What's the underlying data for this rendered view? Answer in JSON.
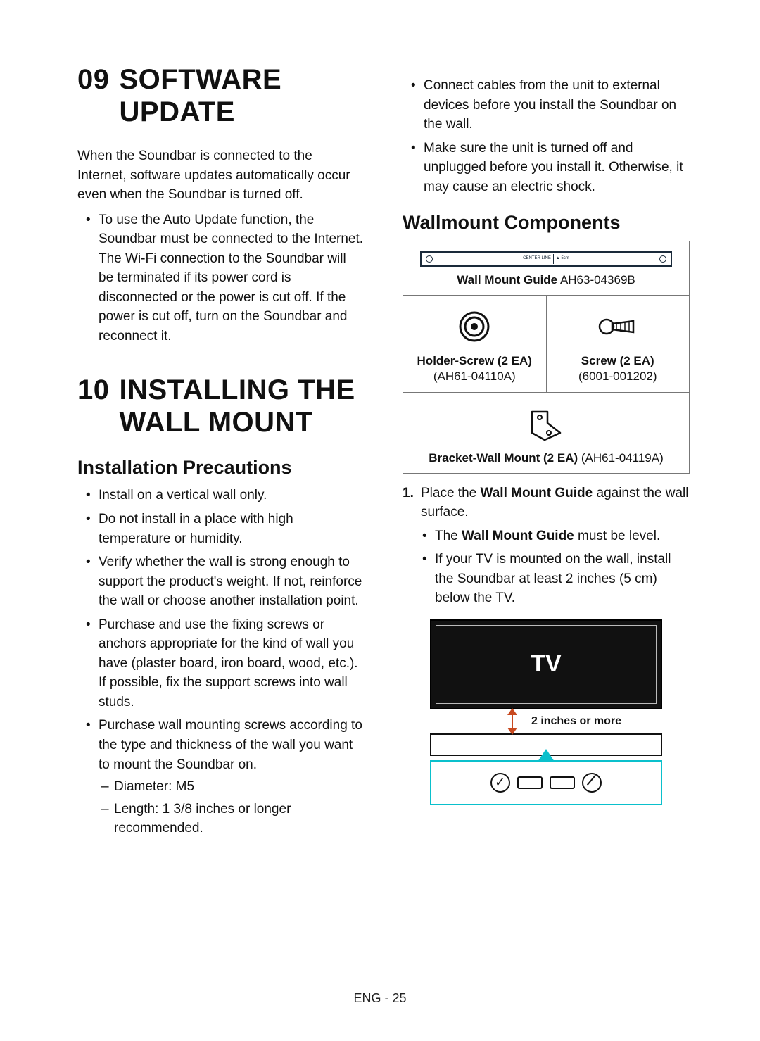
{
  "footer": "ENG - 25",
  "sec09": {
    "num": "09",
    "title": "SOFTWARE UPDATE",
    "intro": "When the Soundbar is connected to the Internet, software updates automatically occur even when the Soundbar is turned off.",
    "bullet": "To use the Auto Update function, the Soundbar must be connected to the Internet. The Wi-Fi connection to the Soundbar will be terminated if its power cord is disconnected or the power is cut off. If the power is cut off, turn on the Soundbar and reconnect it."
  },
  "sec10": {
    "num": "10",
    "title": "INSTALLING THE WALL MOUNT",
    "precautions_title": "Installation Precautions",
    "prec": {
      "p1": "Install on a vertical wall only.",
      "p2": "Do not install in a place with high temperature or humidity.",
      "p3": "Verify whether the wall is strong enough to support the product's weight. If not, reinforce the wall or choose another installation point.",
      "p4": "Purchase and use the fixing screws or anchors appropriate for the kind of wall you have (plaster board, iron board, wood, etc.). If possible, fix the support screws into wall studs.",
      "p5": "Purchase wall mounting screws according to the type and thickness of the wall you want to mount the Soundbar on.",
      "p5a": "Diameter: M5",
      "p5b": "Length: 1 3/8 inches or longer recommended.",
      "p6": "Connect cables from the unit to external devices before you install the Soundbar on the wall.",
      "p7": "Make sure the unit is turned off and unplugged before you install it. Otherwise, it may cause an electric shock."
    },
    "components_title": "Wallmount Components",
    "comp": {
      "guide_name": "Wall Mount Guide",
      "guide_pn": "AH63-04369B",
      "holder_name": "Holder-Screw (2 EA)",
      "holder_pn": "(AH61-04110A)",
      "screw_name": "Screw (2 EA)",
      "screw_pn": "(6001-001202)",
      "bracket_name": "Bracket-Wall Mount (2 EA)",
      "bracket_pn": "(AH61-04119A)"
    },
    "step1_num": "1.",
    "step1_pre": "Place the ",
    "step1_bold": "Wall Mount Guide",
    "step1_post": " against the wall surface.",
    "step1_b1_pre": "The ",
    "step1_b1_bold": "Wall Mount Guide",
    "step1_b1_post": " must be level.",
    "step1_b2": "If your TV is mounted on the wall, install the Soundbar at least 2 inches (5 cm) below the TV.",
    "tv_label": "TV",
    "gap_label": "2 inches or more"
  }
}
